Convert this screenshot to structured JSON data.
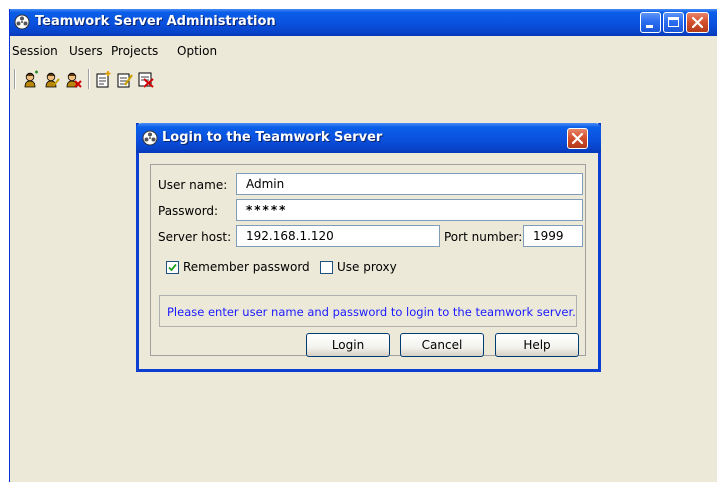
{
  "window": {
    "title": "Teamwork Server Administration"
  },
  "menu": {
    "items": [
      "Session",
      "Users",
      "Projects",
      "Option"
    ]
  },
  "toolbar": {
    "icons": [
      "user-login-icon",
      "user-edit-icon",
      "user-remove-icon",
      "project-add-icon",
      "project-edit-icon",
      "project-remove-icon"
    ]
  },
  "dialog": {
    "title": "Login to the Teamwork Server",
    "username_label": "User name:",
    "username_value": "Admin",
    "password_label": "Password:",
    "password_value": "*****",
    "server_host_label": "Server host:",
    "server_host_value": "192.168.1.120",
    "port_label": "Port number:",
    "port_value": "1999",
    "remember_label": "Remember password",
    "remember_checked": true,
    "proxy_label": "Use proxy",
    "proxy_checked": false,
    "message": "Please enter user name and password to login to the teamwork server.",
    "buttons": {
      "login": "Login",
      "cancel": "Cancel",
      "help": "Help"
    }
  },
  "colors": {
    "titlebar": "#0a52e0",
    "close": "#d4512c",
    "message_text": "#1a1aff",
    "window_bg": "#ece9d8"
  }
}
